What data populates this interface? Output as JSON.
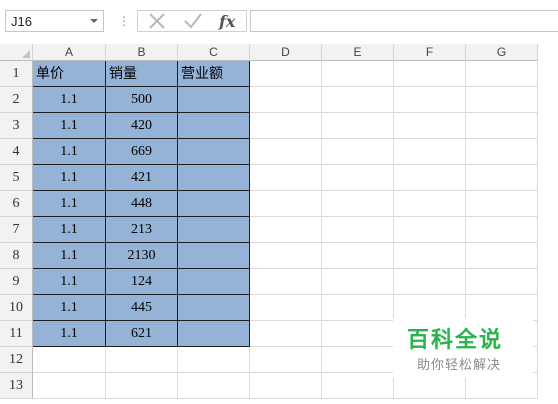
{
  "formula_bar": {
    "name_box": "J16",
    "separator": "⋮",
    "cancel_icon": "cancel-x-icon",
    "enter_icon": "enter-check-icon",
    "function_label": "fx",
    "formula": ""
  },
  "columns": [
    "A",
    "B",
    "C",
    "D",
    "E",
    "F",
    "G"
  ],
  "rows": [
    "1",
    "2",
    "3",
    "4",
    "5",
    "6",
    "7",
    "8",
    "9",
    "10",
    "11",
    "12",
    "13"
  ],
  "table": {
    "headers": [
      "单价",
      "销量",
      "营业额"
    ],
    "data": [
      [
        "1.1",
        "500",
        ""
      ],
      [
        "1.1",
        "420",
        ""
      ],
      [
        "1.1",
        "669",
        ""
      ],
      [
        "1.1",
        "421",
        ""
      ],
      [
        "1.1",
        "448",
        ""
      ],
      [
        "1.1",
        "213",
        ""
      ],
      [
        "1.1",
        "2130",
        ""
      ],
      [
        "1.1",
        "124",
        ""
      ],
      [
        "1.1",
        "445",
        ""
      ],
      [
        "1.1",
        "621",
        ""
      ]
    ]
  },
  "colors": {
    "table_fill": "#95b3d7",
    "header_bg": "#f2f2f2",
    "watermark_green": "#2bb24c"
  },
  "watermark": {
    "title": "百科全说",
    "subtitle": "助你轻松解决"
  }
}
